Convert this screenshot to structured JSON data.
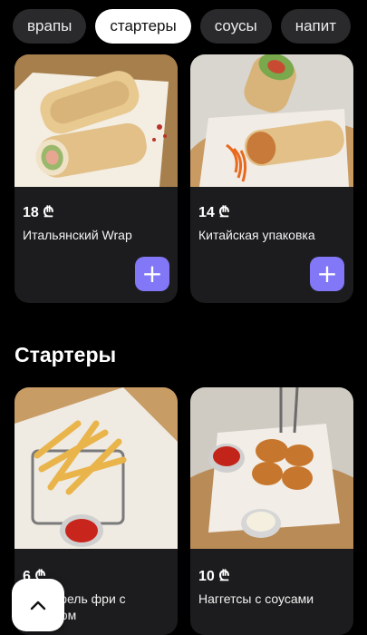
{
  "tabs": [
    {
      "label": "врапы",
      "active": false
    },
    {
      "label": "стартеры",
      "active": true
    },
    {
      "label": "соусы",
      "active": false
    },
    {
      "label": "напит",
      "active": false
    }
  ],
  "wraps": [
    {
      "price": "18 ₾",
      "name": "Итальянский Wrap",
      "add_label": "+"
    },
    {
      "price": "14 ₾",
      "name": "Китайская упаковка",
      "add_label": "+"
    }
  ],
  "starters_section": {
    "title": "Стартеры"
  },
  "starters": [
    {
      "price": "6 ₾",
      "name": "Картофель фри с кетчупом"
    },
    {
      "price": "10 ₾",
      "name": "Наггетсы с соусами"
    }
  ],
  "icons": {
    "add": "plus-icon",
    "scroll_top": "chevron-up-icon"
  },
  "colors": {
    "accent": "#8177f7",
    "card_bg": "#1c1c1e",
    "page_bg": "#000000"
  }
}
